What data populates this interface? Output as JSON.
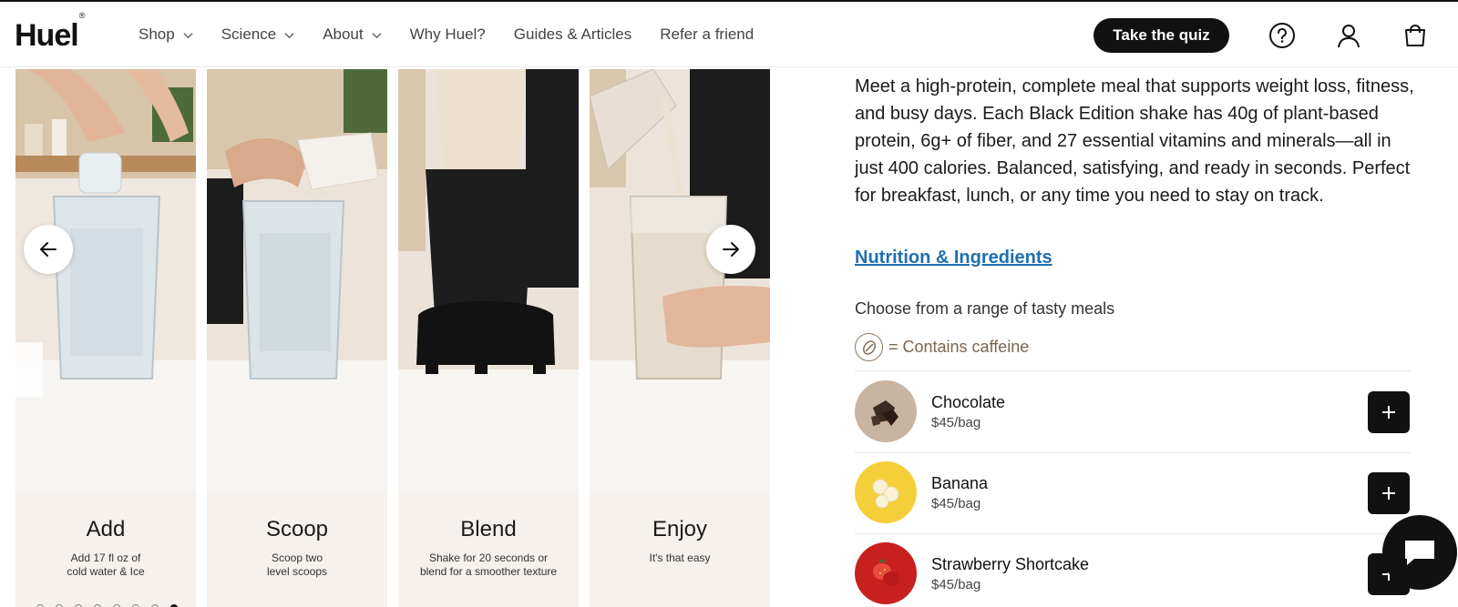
{
  "header": {
    "logo": "Huel",
    "logo_mark": "®",
    "nav": [
      {
        "label": "Shop",
        "dropdown": true
      },
      {
        "label": "Science",
        "dropdown": true
      },
      {
        "label": "About",
        "dropdown": true
      },
      {
        "label": "Why Huel?",
        "dropdown": false
      },
      {
        "label": "Guides & Articles",
        "dropdown": false
      },
      {
        "label": "Refer a friend",
        "dropdown": false
      }
    ],
    "quiz_label": "Take the quiz",
    "icons": [
      "help-icon",
      "account-icon",
      "cart-icon"
    ]
  },
  "carousel": {
    "steps": [
      {
        "title": "Add",
        "desc_line1": "Add 17 fl oz of",
        "desc_line2": "cold water & Ice"
      },
      {
        "title": "Scoop",
        "desc_line1": "Scoop two",
        "desc_line2": "level scoops"
      },
      {
        "title": "Blend",
        "desc_line1": "Shake for 20 seconds or",
        "desc_line2": "blend for a smoother texture"
      },
      {
        "title": "Enjoy",
        "desc_line1": "It's that easy",
        "desc_line2": ""
      }
    ],
    "dots_total": 8,
    "dot_active": 7
  },
  "product": {
    "description": "Meet a high-protein, complete meal that supports weight loss, fitness, and busy days. Each Black Edition shake has 40g of plant-based protein, 6g+ of fiber, and 27 essential vitamins and minerals—all in just 400 calories. Balanced, satisfying, and ready in seconds. Perfect for breakfast, lunch, or any time you need to stay on track.",
    "nutrition_link": "Nutrition & Ingredients",
    "choose_label": "Choose from a range of tasty meals",
    "caffeine_label": "= Contains caffeine",
    "flavors": [
      {
        "name": "Chocolate",
        "price": "$45/bag",
        "color": "#c9b3a1"
      },
      {
        "name": "Banana",
        "price": "$45/bag",
        "color": "#f4cf3a"
      },
      {
        "name": "Strawberry Shortcake",
        "price": "$45/bag",
        "color": "#c8201f"
      }
    ]
  },
  "colors": {
    "accent": "#111111",
    "link": "#1f6fb2",
    "card_bg": "#f6f1ec"
  }
}
